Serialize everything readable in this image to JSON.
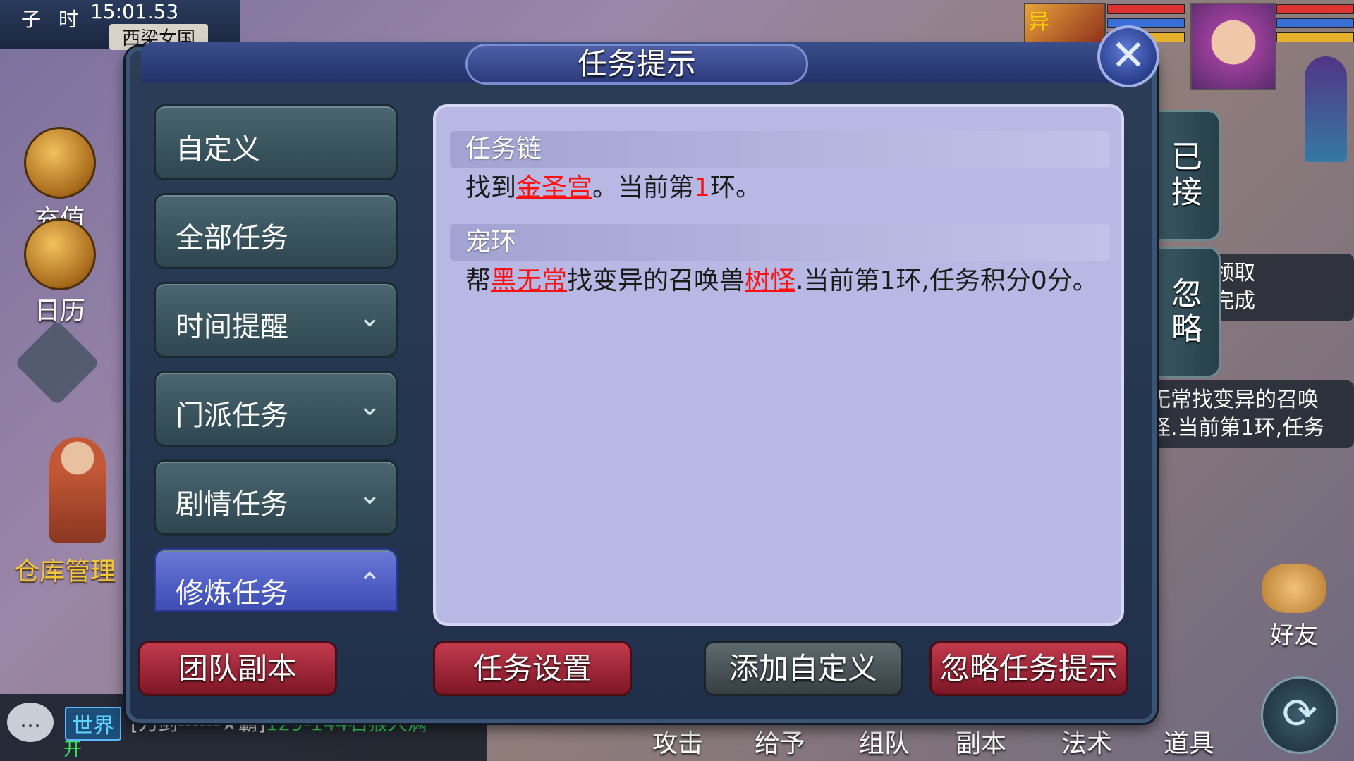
{
  "hud": {
    "hour_label": "子 时",
    "time": "15:01.53",
    "location": "西梁女国",
    "recharge": "充值",
    "calendar": "日历",
    "warehouse": "仓库管理",
    "portrait_tag": "异",
    "friend": "好友",
    "bottom_actions": [
      "攻击",
      "给予",
      "组队",
      "副本",
      "法术",
      "道具"
    ],
    "tracker_top": [
      "皎金处领取",
      "今日已完成"
    ],
    "tracker_bottom": [
      "无常找变异的召唤",
      "怪.当前第1环,任务"
    ],
    "chat_channel": "世界",
    "chat_message_prefix": "[刀剑------★霸]",
    "chat_message_green": "129-144石猴人满",
    "chat_open": "开"
  },
  "side_tabs": {
    "accepted": "已接",
    "ignored": "忽略"
  },
  "dialog": {
    "title": "任务提示",
    "close_symbol": "✕",
    "menu": [
      {
        "label": "自定义",
        "chevron": ""
      },
      {
        "label": "全部任务",
        "chevron": ""
      },
      {
        "label": "时间提醒",
        "chevron": "⌄"
      },
      {
        "label": "门派任务",
        "chevron": "⌄"
      },
      {
        "label": "剧情任务",
        "chevron": "⌄"
      },
      {
        "label": "修炼任务",
        "chevron": "⌃"
      }
    ],
    "sections": [
      {
        "heading": "任务链",
        "text_1": "找到",
        "link": "金圣宫",
        "text_2": "。当前第",
        "num": "1",
        "text_3": "环。"
      },
      {
        "heading": "宠环",
        "text_1": "帮",
        "link_1": "黑无常",
        "text_2": "找变异的召唤兽",
        "link_2": "树怪",
        "text_3": ".当前第1环,任务积分0分。"
      }
    ],
    "buttons": {
      "team_dungeon": "团队副本",
      "task_settings": "任务设置",
      "add_custom": "添加自定义",
      "ignore_hints": "忽略任务提示"
    }
  },
  "colors": {
    "panel_bg": "#b8b8e4",
    "link_red": "#ff1010",
    "active_menu": "#5b69cc",
    "red_button": "#a02838"
  }
}
